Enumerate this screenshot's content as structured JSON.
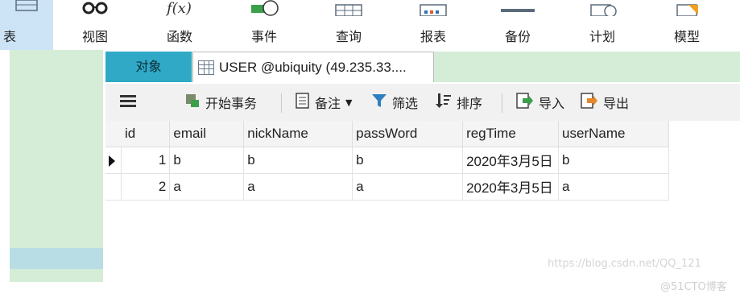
{
  "ribbon": {
    "items": [
      {
        "label": "表"
      },
      {
        "label": "视图"
      },
      {
        "label": "函数"
      },
      {
        "label": "事件"
      },
      {
        "label": "查询"
      },
      {
        "label": "报表"
      },
      {
        "label": "备份"
      },
      {
        "label": "计划"
      },
      {
        "label": "模型"
      }
    ]
  },
  "tabs": {
    "objects": "对象",
    "table_tab": "USER @ubiquity (49.235.33...."
  },
  "toolbar": {
    "begin_transaction": "开始事务",
    "note": "备注",
    "filter": "筛选",
    "sort": "排序",
    "import": "导入",
    "export": "导出"
  },
  "grid": {
    "columns": [
      "id",
      "email",
      "nickName",
      "passWord",
      "regTime",
      "userName"
    ],
    "rows": [
      {
        "id": "1",
        "email": "b",
        "nickName": "b",
        "passWord": "b",
        "regTime": "2020年3月5日",
        "userName": "b"
      },
      {
        "id": "2",
        "email": "a",
        "nickName": "a",
        "passWord": "a",
        "regTime": "2020年3月5日",
        "userName": "a"
      }
    ]
  },
  "watermarks": {
    "blog": "https://blog.csdn.net/QQ_121",
    "site": "@51CTO博客"
  },
  "colors": {
    "accent_tab": "#2fa9c6",
    "panel_green": "#d5ecd6",
    "ribbon_active": "#cde4f7"
  }
}
